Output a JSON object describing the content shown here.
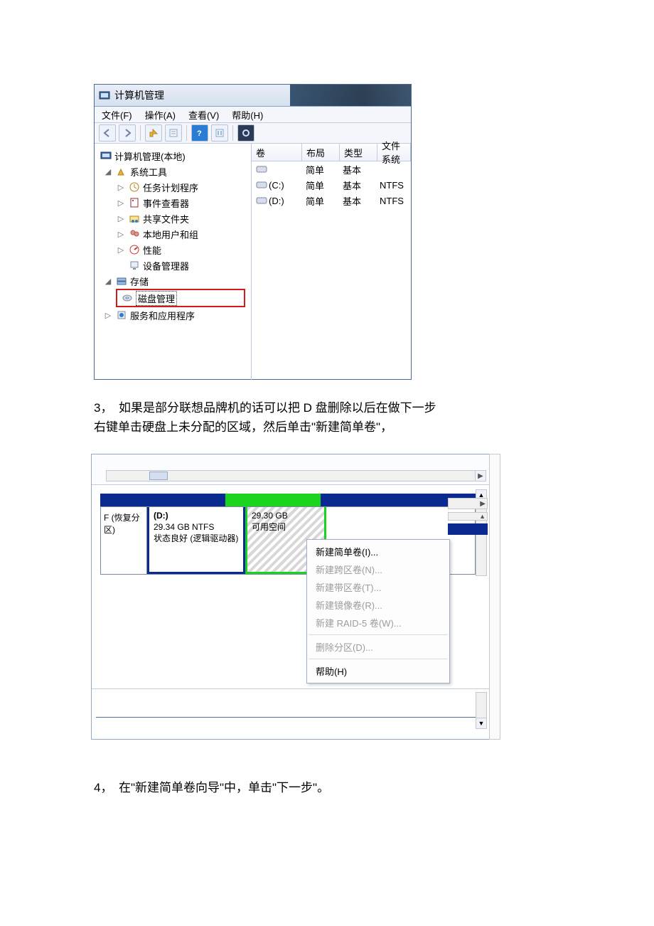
{
  "win_title": "计算机管理",
  "menubar": {
    "file": "文件(F)",
    "action": "操作(A)",
    "view": "查看(V)",
    "help": "帮助(H)"
  },
  "tree": {
    "root": "计算机管理(本地)",
    "systools": "系统工具",
    "task": "任务计划程序",
    "event": "事件查看器",
    "shared": "共享文件夹",
    "users": "本地用户和组",
    "perf": "性能",
    "devmgr": "设备管理器",
    "storage": "存储",
    "diskmgmt": "磁盘管理",
    "services": "服务和应用程序"
  },
  "volumes": {
    "headers": {
      "vol": "卷",
      "layout": "布局",
      "type": "类型",
      "fs": "文件系统"
    },
    "rows": [
      {
        "name": "",
        "layout": "简单",
        "type": "基本",
        "fs": ""
      },
      {
        "name": "(C:)",
        "layout": "简单",
        "type": "基本",
        "fs": "NTFS"
      },
      {
        "name": "(D:)",
        "layout": "简单",
        "type": "基本",
        "fs": "NTFS"
      }
    ]
  },
  "doc": {
    "p3a": "3，　如果是部分联想品牌机的话可以把 D 盘删除以后在做下一步",
    "p3b": "右键单击硬盘上未分配的区域，然后单击\"新建简单卷\"，",
    "p4": "4，　在\"新建简单卷向导\"中，单击\"下一步\"。"
  },
  "disk2": {
    "recovery": "F (恢复分区)",
    "d_label": "(D:)",
    "d_size": "29.34 GB NTFS",
    "d_state": "状态良好 (逻辑驱动器)",
    "free_size": "29.30 GB",
    "free_label": "可用空间"
  },
  "ctx": {
    "simple": "新建简单卷(I)...",
    "spanned": "新建跨区卷(N)...",
    "striped": "新建带区卷(T)...",
    "mirror": "新建镜像卷(R)...",
    "raid5": "新建 RAID-5 卷(W)...",
    "delpart": "删除分区(D)...",
    "help": "帮助(H)"
  }
}
